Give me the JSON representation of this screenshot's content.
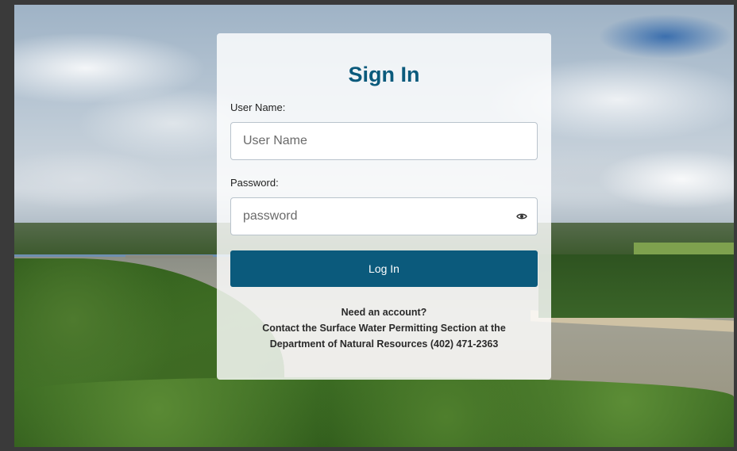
{
  "login": {
    "title": "Sign In",
    "username_label": "User Name:",
    "username_placeholder": "User Name",
    "username_value": "",
    "password_label": "Password:",
    "password_placeholder": "password",
    "password_value": "",
    "show_password_icon": "eye-icon",
    "login_button": "Log In"
  },
  "account_note": {
    "line1": "Need an account?",
    "line2": "Contact the Surface Water Permitting Section at the",
    "line3": "Department of Natural Resources (402) 471-2363"
  },
  "colors": {
    "brand": "#0b5a7c",
    "card_background": "rgba(255,255,255,0.82)"
  }
}
